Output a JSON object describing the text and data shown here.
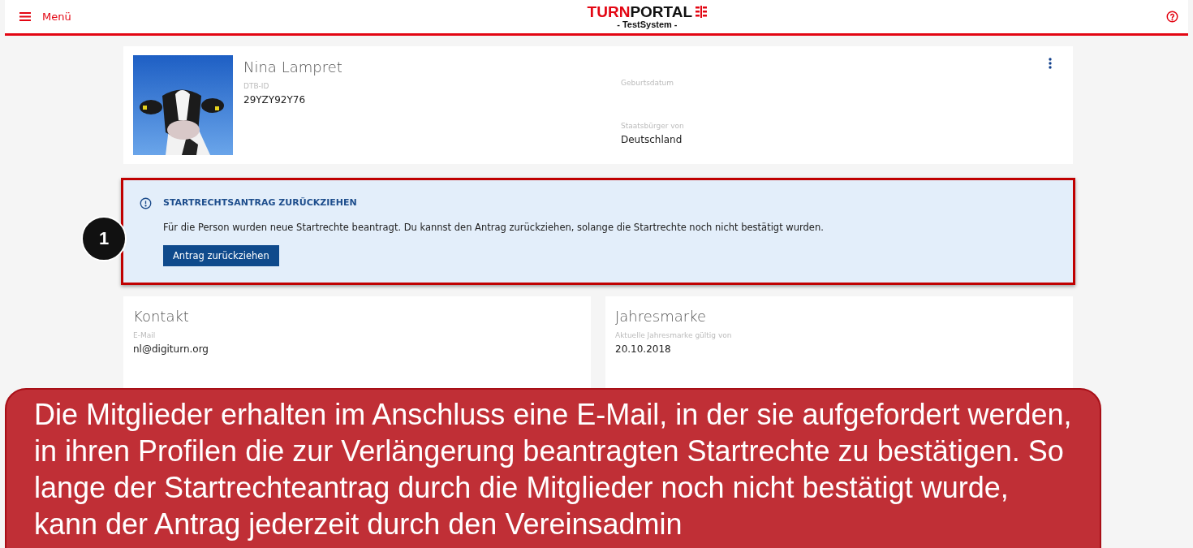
{
  "header": {
    "menu_label": "Menü",
    "logo_primary": "TURN",
    "logo_secondary": "PORTAL",
    "subtitle": "- TestSystem -"
  },
  "profile": {
    "name": "Nina Lampret",
    "fields": [
      {
        "label": "DTB-ID",
        "value": "29YZY92Y76"
      },
      {
        "label": "Geburtsdatum"
      },
      {
        "label": "Staatsbürger von",
        "value": "Deutschland"
      }
    ]
  },
  "alert": {
    "title": "STARTRECHTSANTRAG ZURÜCKZIEHEN",
    "text": "Für die Person wurden neue Startrechte beantragt. Du kannst den Antrag zurückziehen, solange die Startrechte noch nicht bestätigt wurden.",
    "button": "Antrag zurückziehen",
    "highlighted": true,
    "step_badge": "1"
  },
  "cards": [
    {
      "title": "Kontakt",
      "fields": [
        {
          "label": "E-Mail",
          "value": "nl@digiturn.org"
        }
      ]
    },
    {
      "title": "Jahresmarke",
      "fields": [
        {
          "label": "Aktuelle Jahresmarke gültig von",
          "value": "20.10.2018"
        }
      ]
    }
  ],
  "callout": {
    "text": "Die Mitglieder erhalten im Anschluss eine E-Mail, in der sie aufgefordert werden, in ihren Profilen die zur Verlängerung beantragten Startrechte zu bestätigen. So lange der Startrechteantrag durch die Mitglieder noch nicht bestätigt wurde, kann der Antrag jederzeit durch den Vereinsadmin"
  }
}
